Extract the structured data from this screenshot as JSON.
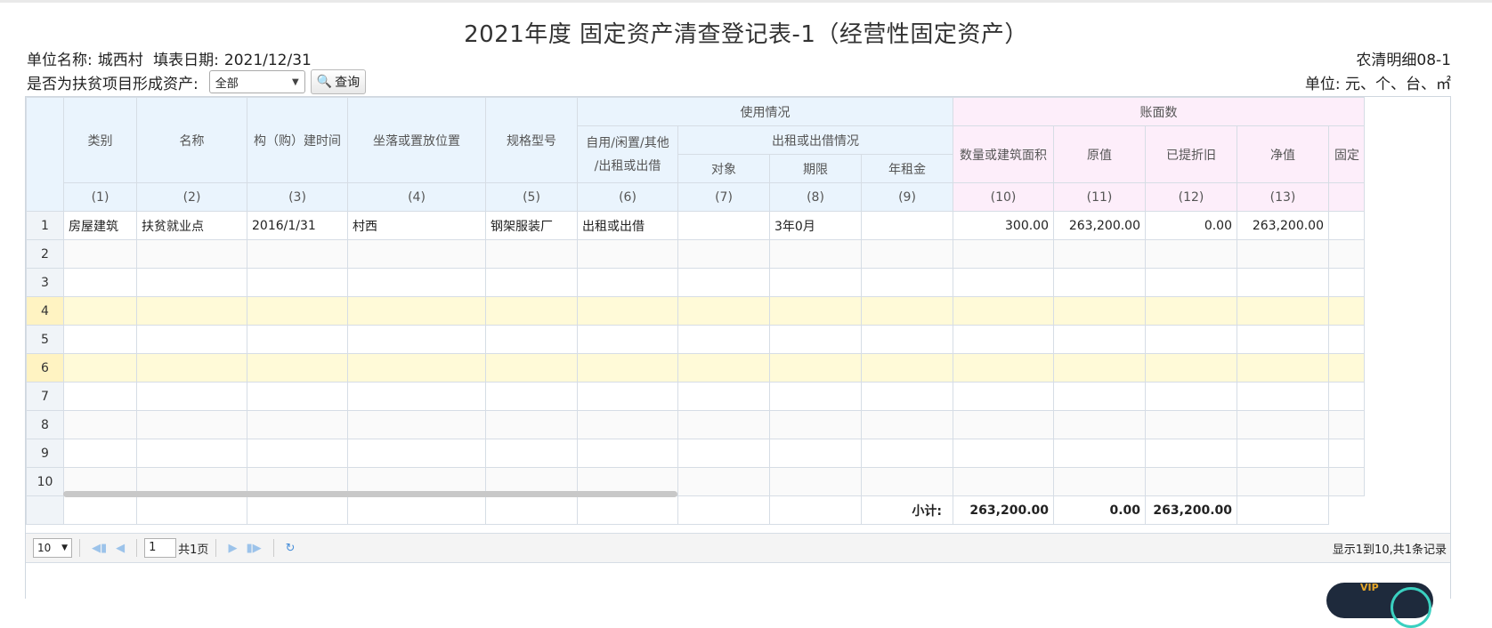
{
  "title": "2021年度 固定资产清查登记表-1（经营性固定资产）",
  "info": {
    "unit_label": "单位名称:",
    "unit_value": "城西村",
    "date_label": "填表日期:",
    "date_value": "2021/12/31",
    "code": "农清明细08-1",
    "units": "单位: 元、个、台、㎡"
  },
  "filter": {
    "label": "是否为扶贫项目形成资产:",
    "selected": "全部",
    "query_button": "查询"
  },
  "header": {
    "category": "类别",
    "name": "名称",
    "build_time": "构（购）建时间",
    "location": "坐落或置放位置",
    "spec": "规格型号",
    "usage": "使用情况",
    "usage_status": [
      "自用/闲置/其他",
      "/出租或出借"
    ],
    "lease": "出租或出借情况",
    "lease_target": "对象",
    "lease_term": "期限",
    "annual_rent": "年租金",
    "book": "账面数",
    "quantity": "数量或建筑面积",
    "original": "原值",
    "depreciation": "已提折旧",
    "net": "净值",
    "fixed_partial": "固定",
    "col_nums": [
      "(1)",
      "(2)",
      "(3)",
      "(4)",
      "(5)",
      "(6)",
      "(7)",
      "(8)",
      "(9)",
      "(10)",
      "(11)",
      "(12)",
      "(13)"
    ]
  },
  "rows": [
    {
      "no": "1",
      "category": "房屋建筑",
      "name": "扶贫就业点",
      "build_time": "2016/1/31",
      "location": "村西",
      "spec": "钢架服装厂",
      "status": "出租或出借",
      "target": "",
      "term": "3年0月",
      "rent": "",
      "quantity": "300.00",
      "original": "263,200.00",
      "depreciation": "0.00",
      "net": "263,200.00"
    },
    {
      "no": "2"
    },
    {
      "no": "3"
    },
    {
      "no": "4"
    },
    {
      "no": "5"
    },
    {
      "no": "6"
    },
    {
      "no": "7"
    },
    {
      "no": "8"
    },
    {
      "no": "9"
    },
    {
      "no": "10"
    }
  ],
  "totals": {
    "label": "小计:",
    "original": "263,200.00",
    "depreciation": "0.00",
    "net": "263,200.00"
  },
  "pager": {
    "page_size": "10",
    "current_page": "1",
    "total_pages": "共1页",
    "info": "显示1到10,共1条记录"
  },
  "badge_text": "VIP"
}
